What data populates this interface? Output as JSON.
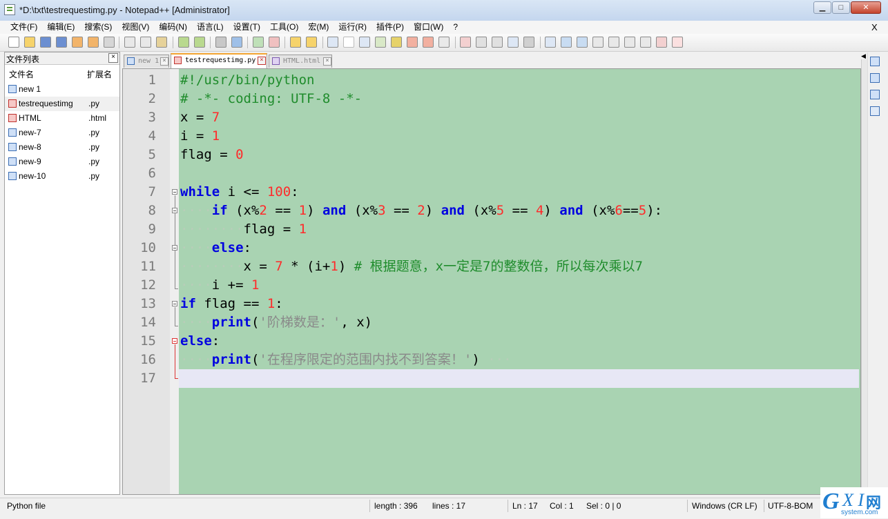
{
  "window": {
    "title": "*D:\\txt\\testrequestimg.py - Notepad++ [Administrator]",
    "min_label": "▁",
    "max_label": "□",
    "close_label": "✕"
  },
  "menu": {
    "items": [
      "文件(F)",
      "编辑(E)",
      "搜索(S)",
      "视图(V)",
      "编码(N)",
      "语言(L)",
      "设置(T)",
      "工具(O)",
      "宏(M)",
      "运行(R)",
      "插件(P)",
      "窗口(W)",
      "?"
    ],
    "close_x": "X"
  },
  "file_panel": {
    "title": "文件列表",
    "close_label": "×",
    "col_name": "文件名",
    "col_ext": "扩展名",
    "files": [
      {
        "name": "new 1",
        "ext": ""
      },
      {
        "name": "testrequestimg",
        "ext": ".py"
      },
      {
        "name": "HTML",
        "ext": ".html"
      },
      {
        "name": "new-7",
        "ext": ".py"
      },
      {
        "name": "new-8",
        "ext": ".py"
      },
      {
        "name": "new-9",
        "ext": ".py"
      },
      {
        "name": "new-10",
        "ext": ".py"
      }
    ]
  },
  "tabs": [
    {
      "label": "new 1",
      "close": "×"
    },
    {
      "label": "testrequestimg.py",
      "close": "×"
    },
    {
      "label": "HTML.html",
      "close": "×"
    }
  ],
  "tab_nav": "◀ ▶",
  "editor": {
    "line_numbers": [
      "1",
      "2",
      "3",
      "4",
      "5",
      "6",
      "7",
      "8",
      "9",
      "10",
      "11",
      "12",
      "13",
      "14",
      "15",
      "16",
      "17"
    ],
    "tok": {
      "l1": "#!/usr/bin/python",
      "l2": "# -*- coding: UTF-8 -*-",
      "l3a": "x = ",
      "l3b": "7",
      "l4a": "i = ",
      "l4b": "1",
      "l5a": "flag = ",
      "l5b": "0",
      "l7a": "while",
      "l7b": " i <= ",
      "l7c": "100",
      "l7d": ":",
      "l8i": "····",
      "l8a": "if",
      "l8b": " (x%",
      "l8c": "2",
      "l8d": " == ",
      "l8e": "1",
      "l8f": ") ",
      "l8g": "and",
      "l8h": " (x%",
      "l8j": "3",
      "l8k": " == ",
      "l8l": "2",
      "l8m": ") ",
      "l8n": "and",
      "l8o": " (x%",
      "l8p": "5",
      "l8q": " == ",
      "l8r": "4",
      "l8s": ") ",
      "l8t": "and",
      "l8u": " (x%",
      "l8v": "6",
      "l8w": "==",
      "l8x": "5",
      "l8y": "):",
      "l9i": "········",
      "l9a": "flag = ",
      "l9b": "1",
      "l10i": "····",
      "l10a": "else",
      "l10b": ":",
      "l11i": "········",
      "l11a": "x = ",
      "l11b": "7",
      "l11c": " * (i+",
      "l11d": "1",
      "l11e": ") ",
      "l11f": "# 根据题意，x一定是7的整数倍，所以每次乘以7",
      "l12i": "····",
      "l12a": "i += ",
      "l12b": "1",
      "l13a": "if",
      "l13b": " flag == ",
      "l13c": "1",
      "l13d": ":",
      "l14i": "····",
      "l14a": "print",
      "l14b": "(",
      "l14c": "'阶梯数是：'",
      "l14d": ", x)",
      "l15a": "else",
      "l15b": ":",
      "l16i": "····",
      "l16a": "print",
      "l16b": "(",
      "l16c": "'在程序限定的范围内找不到答案！'",
      "l16d": ")",
      "l16e": " ···"
    }
  },
  "status": {
    "file_type": "Python file",
    "length": "length : 396",
    "lines": "lines : 17",
    "ln": "Ln : 17",
    "col": "Col : 1",
    "sel": "Sel : 0 | 0",
    "eol": "Windows (CR LF)",
    "encoding": "UTF-8-BOM"
  },
  "watermark": {
    "g": "G",
    "xi": "X I",
    "wang": "网",
    "site": "system.com"
  },
  "colors": {
    "editor_bg": "#a9d3b2",
    "keyword": "#0000e0",
    "number": "#ff2a2a",
    "comment": "#1f8c2c",
    "string": "#8a8a8a",
    "current_line": "#e7e7f5",
    "active_tab_accent": "#f3a530"
  }
}
